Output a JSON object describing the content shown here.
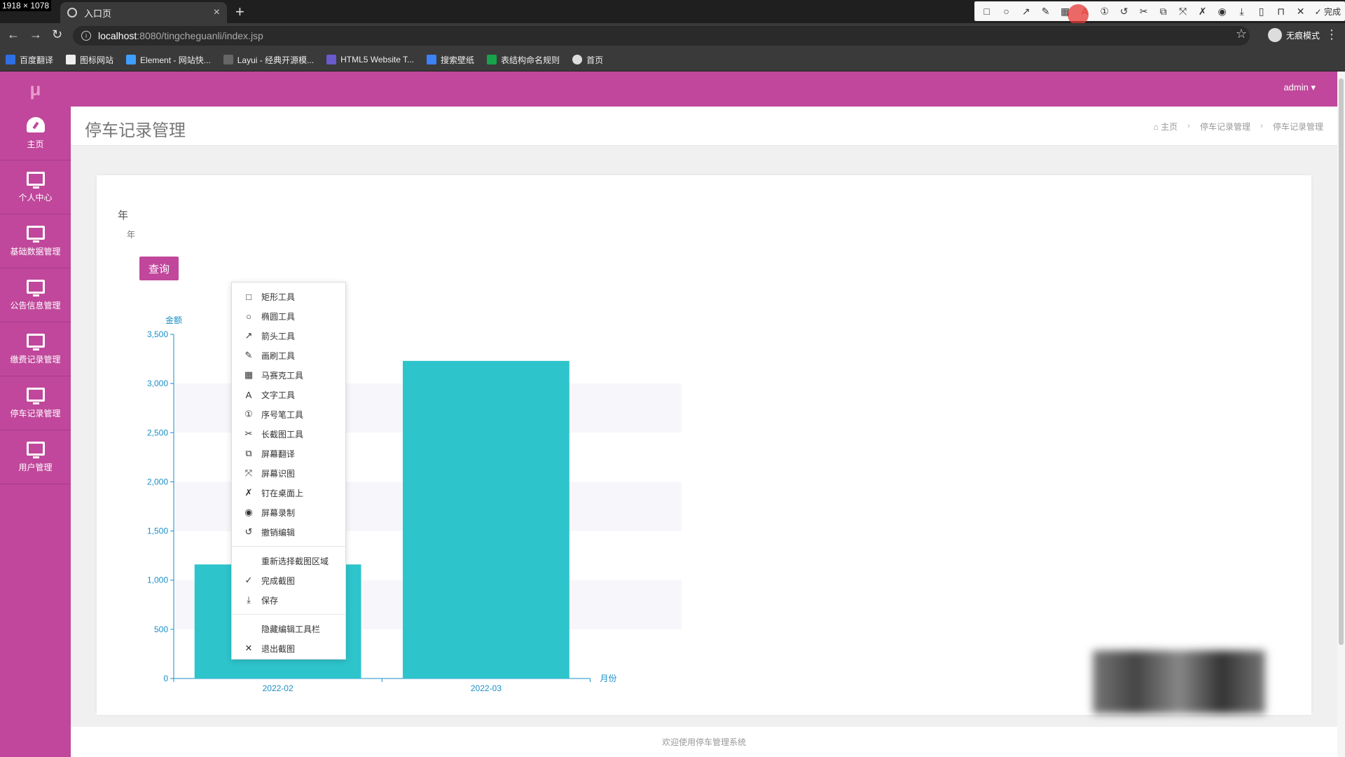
{
  "window": {
    "dimensions_badge": "1918 × 1078"
  },
  "browser": {
    "tab_title": "入口页",
    "url_host": "localhost",
    "url_path": ":8080/tingcheguanli/index.jsp",
    "incognito_label": "无痕模式",
    "bookmarks": [
      "百度翻译",
      "图标网站",
      "Element - 网站快...",
      "Layui - 经典开源模...",
      "HTML5 Website T...",
      "搜索壁纸",
      "表结构命名规则",
      "首页"
    ],
    "snip_done_label": "完成"
  },
  "colors": {
    "brand": "#c0479b",
    "bar": "#2ec4cc",
    "axis": "#1a8fc7"
  },
  "app": {
    "logo": "μ",
    "user": "admin ▾",
    "sidebar": [
      {
        "label": "主页",
        "icon": "dashboard-icon"
      },
      {
        "label": "个人中心",
        "icon": "monitor-icon"
      },
      {
        "label": "基础数据管理",
        "icon": "monitor-icon"
      },
      {
        "label": "公告信息管理",
        "icon": "monitor-icon"
      },
      {
        "label": "缴费记录管理",
        "icon": "monitor-icon"
      },
      {
        "label": "停车记录管理",
        "icon": "monitor-icon"
      },
      {
        "label": "用户管理",
        "icon": "monitor-icon"
      }
    ],
    "page_title": "停车记录管理",
    "breadcrumb": [
      "主页",
      "停车记录管理",
      "停车记录管理"
    ],
    "filter": {
      "year_label": "年",
      "year_placeholder": "年",
      "query_button": "查询"
    },
    "footer": "欢迎使用停车管理系统"
  },
  "chart_data": {
    "type": "bar",
    "categories": [
      "2022-02",
      "2022-03"
    ],
    "values": [
      1160,
      3230
    ],
    "xlabel": "月份",
    "ylabel": "金额",
    "ylim": [
      0,
      3500
    ],
    "yticks": [
      0,
      500,
      1000,
      1500,
      2000,
      2500,
      3000,
      3500
    ],
    "ytick_labels": [
      "0",
      "500",
      "1,000",
      "1,500",
      "2,000",
      "2,500",
      "3,000",
      "3,500"
    ],
    "grid": "alternating bands"
  },
  "snip_menu": {
    "tools": [
      {
        "label": "矩形工具",
        "icon": "rectangle-icon"
      },
      {
        "label": "椭圆工具",
        "icon": "ellipse-icon"
      },
      {
        "label": "箭头工具",
        "icon": "arrow-icon"
      },
      {
        "label": "画刷工具",
        "icon": "brush-icon"
      },
      {
        "label": "马赛克工具",
        "icon": "mosaic-icon"
      },
      {
        "label": "文字工具",
        "icon": "text-icon"
      },
      {
        "label": "序号笔工具",
        "icon": "number-pen-icon"
      },
      {
        "label": "长截图工具",
        "icon": "long-screenshot-icon"
      },
      {
        "label": "屏幕翻译",
        "icon": "translate-icon"
      },
      {
        "label": "屏幕识图",
        "icon": "recognize-icon"
      },
      {
        "label": "钉在桌面上",
        "icon": "pin-icon"
      },
      {
        "label": "屏幕录制",
        "icon": "record-icon"
      },
      {
        "label": "撤销编辑",
        "icon": "undo-icon"
      }
    ],
    "actions": [
      {
        "label": "重新选择截图区域",
        "icon": ""
      },
      {
        "label": "完成截图",
        "icon": "check-icon"
      },
      {
        "label": "保存",
        "icon": "save-icon"
      }
    ],
    "footer_actions": [
      {
        "label": "隐藏编辑工具栏",
        "icon": ""
      },
      {
        "label": "退出截图",
        "icon": "close-icon"
      }
    ]
  }
}
